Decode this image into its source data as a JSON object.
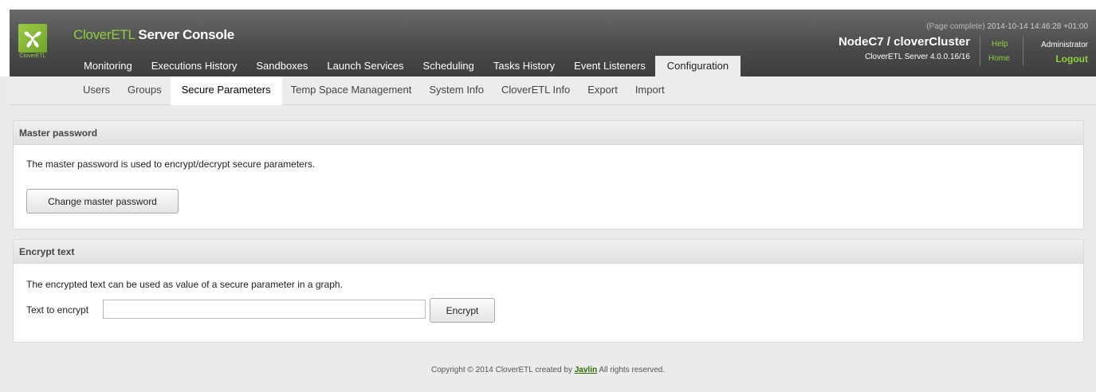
{
  "header": {
    "logo_text": "CloverETL",
    "title_brand": "CloverETL",
    "title_rest": "Server Console",
    "page_status": "(Page complete)",
    "timestamp": "2014-10-14 14:46:28 +01:00",
    "node": "NodeC7 / cloverCluster",
    "version": "CloverETL Server 4.0.0.16/16",
    "help": "Help",
    "home": "Home",
    "user": "Administrator",
    "logout": "Logout",
    "accent": "#8fd13f"
  },
  "nav": {
    "items": [
      "Monitoring",
      "Executions History",
      "Sandboxes",
      "Launch Services",
      "Scheduling",
      "Tasks History",
      "Event Listeners",
      "Configuration"
    ],
    "active": "Configuration"
  },
  "subnav": {
    "items": [
      "Users",
      "Groups",
      "Secure Parameters",
      "Temp Space Management",
      "System Info",
      "CloverETL Info",
      "Export",
      "Import"
    ],
    "active": "Secure Parameters"
  },
  "master_password": {
    "header": "Master password",
    "description": "The master password is used to encrypt/decrypt secure parameters.",
    "button": "Change master password"
  },
  "encrypt_text": {
    "header": "Encrypt text",
    "description": "The encrypted text can be used as value of a secure parameter in a graph.",
    "label": "Text to encrypt",
    "value": "",
    "button": "Encrypt"
  },
  "footer": {
    "prefix": "Copyright © 2014 CloverETL created by",
    "link": "Javlin",
    "suffix": "All rights reserved."
  }
}
